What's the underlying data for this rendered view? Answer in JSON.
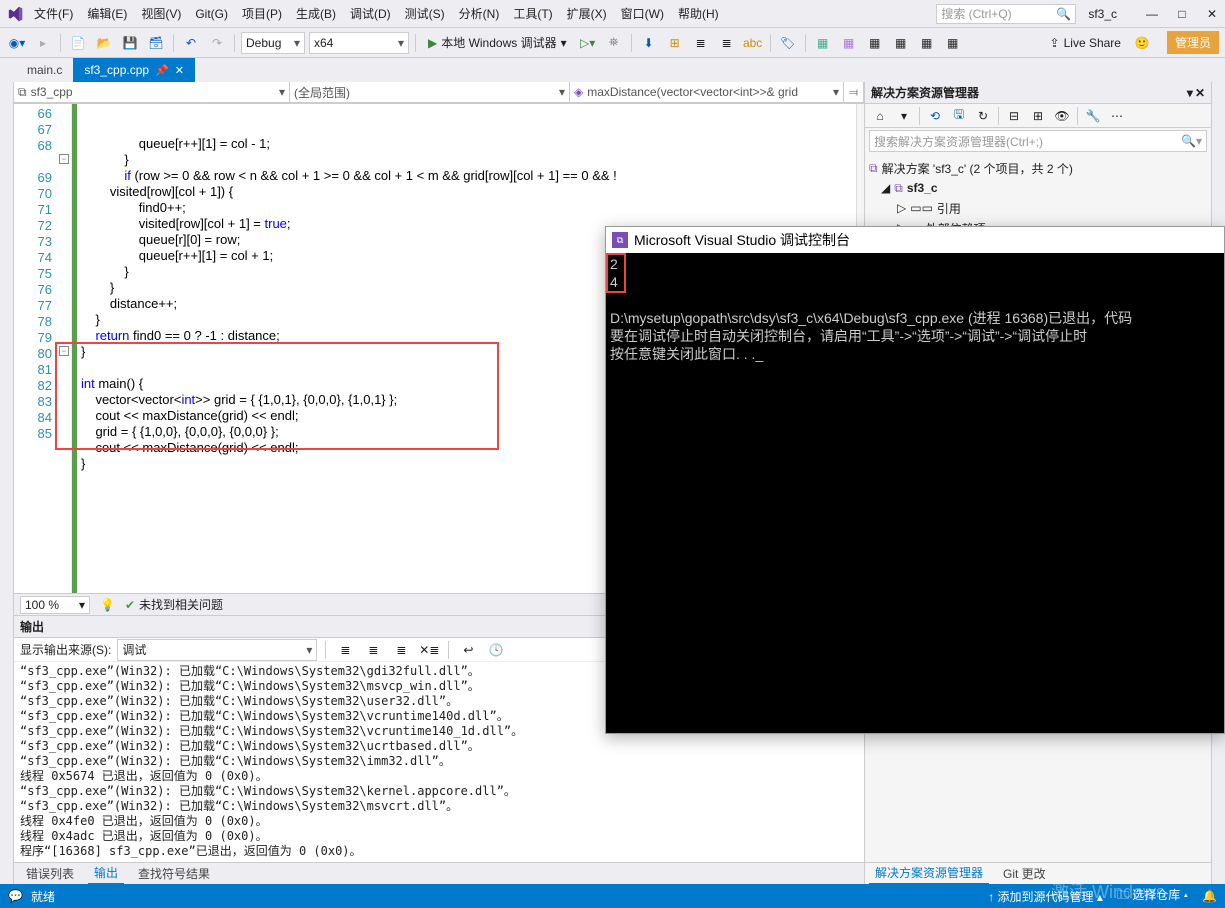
{
  "menu": {
    "items": [
      "文件(F)",
      "编辑(E)",
      "视图(V)",
      "Git(G)",
      "项目(P)",
      "生成(B)",
      "调试(D)",
      "测试(S)",
      "分析(N)",
      "工具(T)",
      "扩展(X)",
      "窗口(W)",
      "帮助(H)"
    ],
    "search_placeholder": "搜索 (Ctrl+Q)",
    "project": "sf3_c"
  },
  "toolbar": {
    "config": "Debug",
    "platform": "x64",
    "run": "本地 Windows 调试器",
    "live": "Live Share",
    "admin": "管理员"
  },
  "tabs": {
    "inactive": "main.c",
    "active": "sf3_cpp.cpp"
  },
  "nav": {
    "left": "sf3_cpp",
    "mid": "(全局范围)",
    "right": "maxDistance(vector<vector<int>>& grid"
  },
  "code": {
    "lines": [
      {
        "n": 66,
        "t": "                queue[r++][1] = col - 1;"
      },
      {
        "n": 67,
        "t": "            }"
      },
      {
        "n": 68,
        "t": "            if (row >= 0 && row < n && col + 1 >= 0 && col + 1 < m && grid[row][col + 1] == 0 && !"
      },
      {
        "n": 0,
        "t": "        visited[row][col + 1]) {"
      },
      {
        "n": 69,
        "t": "                find0++;"
      },
      {
        "n": 70,
        "t": "                visited[row][col + 1] = true;"
      },
      {
        "n": 71,
        "t": "                queue[r][0] = row;"
      },
      {
        "n": 72,
        "t": "                queue[r++][1] = col + 1;"
      },
      {
        "n": 73,
        "t": "            }"
      },
      {
        "n": 74,
        "t": "        }"
      },
      {
        "n": 75,
        "t": "        distance++;"
      },
      {
        "n": 76,
        "t": "    }"
      },
      {
        "n": 77,
        "t": "    return find0 == 0 ? -1 : distance;"
      },
      {
        "n": 78,
        "t": "}"
      },
      {
        "n": 79,
        "t": ""
      },
      {
        "n": 80,
        "t": "int main() {"
      },
      {
        "n": 81,
        "t": "    vector<vector<int>> grid = { {1,0,1}, {0,0,0}, {1,0,1} };"
      },
      {
        "n": 82,
        "t": "    cout << maxDistance(grid) << endl;"
      },
      {
        "n": 83,
        "t": "    grid = { {1,0,0}, {0,0,0}, {0,0,0} };"
      },
      {
        "n": 84,
        "t": "    cout << maxDistance(grid) << endl;"
      },
      {
        "n": 85,
        "t": "}"
      }
    ]
  },
  "edfoot": {
    "zoom": "100 %",
    "issues": "未找到相关问题"
  },
  "outpanel": {
    "title": "输出",
    "src_label": "显示输出来源(S):",
    "src_value": "调试",
    "lines": [
      "“sf3_cpp.exe”(Win32): 已加载“C:\\Windows\\System32\\gdi32full.dll”。",
      "“sf3_cpp.exe”(Win32): 已加载“C:\\Windows\\System32\\msvcp_win.dll”。",
      "“sf3_cpp.exe”(Win32): 已加载“C:\\Windows\\System32\\user32.dll”。",
      "“sf3_cpp.exe”(Win32): 已加载“C:\\Windows\\System32\\vcruntime140d.dll”。",
      "“sf3_cpp.exe”(Win32): 已加载“C:\\Windows\\System32\\vcruntime140_1d.dll”。",
      "“sf3_cpp.exe”(Win32): 已加载“C:\\Windows\\System32\\ucrtbased.dll”。",
      "“sf3_cpp.exe”(Win32): 已加载“C:\\Windows\\System32\\imm32.dll”。",
      "线程 0x5674 已退出，返回值为 0 (0x0)。",
      "“sf3_cpp.exe”(Win32): 已加载“C:\\Windows\\System32\\kernel.appcore.dll”。",
      "“sf3_cpp.exe”(Win32): 已加载“C:\\Windows\\System32\\msvcrt.dll”。",
      "线程 0x4fe0 已退出，返回值为 0 (0x0)。",
      "线程 0x4adc 已退出，返回值为 0 (0x0)。",
      "程序“[16368] sf3_cpp.exe”已退出，返回值为 0 (0x0)。"
    ]
  },
  "bottomtabs": {
    "errors": "错误列表",
    "output": "输出",
    "symbols": "查找符号结果"
  },
  "se": {
    "title": "解决方案资源管理器",
    "search": "搜索解决方案资源管理器(Ctrl+;)",
    "root": "解决方案 'sf3_c' (2 个项目，共 2 个)",
    "proj": "sf3_c",
    "ref": "引用",
    "ext": "外部依赖项",
    "t1": "解决方案资源管理器",
    "t2": "Git 更改"
  },
  "status": {
    "ready": "就绪",
    "src": "添加到源代码管理",
    "repo": "选择仓库",
    "watermark": "激活 Windows"
  },
  "console": {
    "title": "Microsoft Visual Studio 调试控制台",
    "out1": "2",
    "out2": "4",
    "body": "D:\\mysetup\\gopath\\src\\dsy\\sf3_c\\x64\\Debug\\sf3_cpp.exe (进程 16368)已退出，代码\n要在调试停止时自动关闭控制台，请启用“工具”->“选项”->“调试”->“调试停止时\n按任意键关闭此窗口. . ._"
  }
}
